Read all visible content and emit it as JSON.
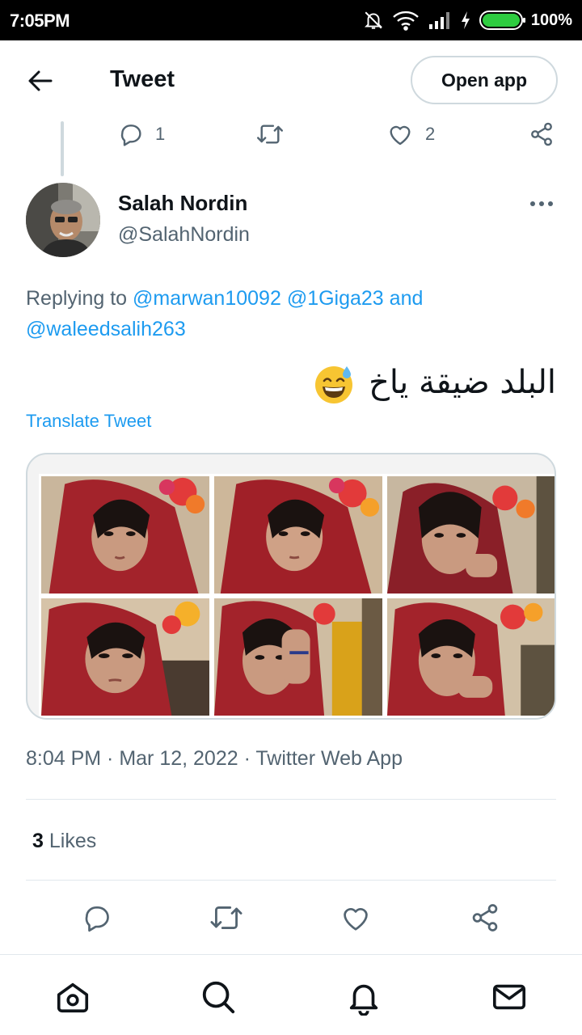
{
  "status_bar": {
    "time": "7:05PM",
    "battery_percent": "100%",
    "battery_level": 1.0,
    "icons": [
      "mute-icon",
      "wifi-icon",
      "signal-icon",
      "charging-icon",
      "battery-icon"
    ]
  },
  "header": {
    "title": "Tweet",
    "open_app_label": "Open app"
  },
  "previous_tweet_actions": {
    "reply_count": "1",
    "like_count": "2"
  },
  "tweet": {
    "author_name": "Salah Nordin",
    "author_handle": "@SalahNordin",
    "replying_to_prefix": "Replying to",
    "mentions": [
      "@marwan10092",
      "@1Giga23",
      "and",
      "@waleedsalih263"
    ],
    "text": "البلد ضيقة ياخ",
    "translate_label": "Translate Tweet",
    "timestamp": "8:04 PM · Mar 12, 2022 · Twitter Web App",
    "likes_count": "3",
    "likes_label": "Likes"
  },
  "colors": {
    "accent": "#1d9bf0",
    "text_primary": "#0f1419",
    "text_secondary": "#536471",
    "border": "#cfd9de"
  }
}
